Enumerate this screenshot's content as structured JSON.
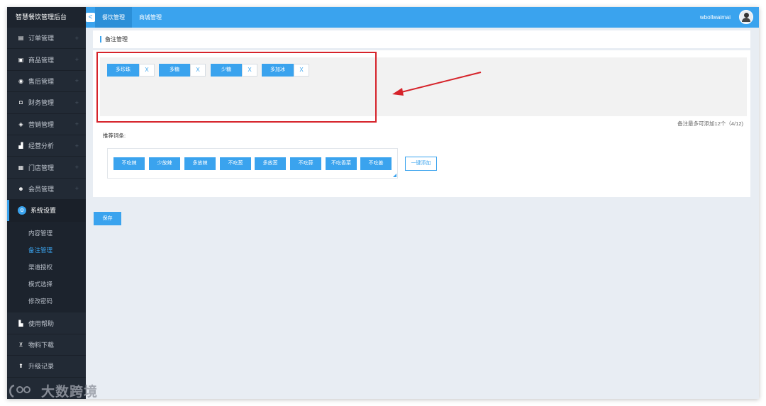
{
  "app": {
    "title": "智慧餐饮管理后台"
  },
  "sidebar": {
    "items": [
      {
        "label": "订单管理",
        "icon": "document-icon"
      },
      {
        "label": "商品管理",
        "icon": "box-icon"
      },
      {
        "label": "售后管理",
        "icon": "eye-icon"
      },
      {
        "label": "财务管理",
        "icon": "wallet-icon"
      },
      {
        "label": "营销管理",
        "icon": "megaphone-icon"
      },
      {
        "label": "经营分析",
        "icon": "bar-chart-icon"
      },
      {
        "label": "门店管理",
        "icon": "store-icon"
      },
      {
        "label": "会员管理",
        "icon": "users-icon"
      },
      {
        "label": "系统设置",
        "icon": "settings-icon"
      }
    ],
    "sub_items": [
      {
        "label": "内容管理"
      },
      {
        "label": "备注管理"
      },
      {
        "label": "渠道授权"
      },
      {
        "label": "模式选择"
      },
      {
        "label": "修改密码"
      }
    ],
    "bottom_items": [
      {
        "label": "使用帮助",
        "icon": "book-icon"
      },
      {
        "label": "物料下载",
        "icon": "download-icon"
      },
      {
        "label": "升级记录",
        "icon": "upgrade-icon"
      }
    ],
    "plus_symbol": "+"
  },
  "topbar": {
    "tabs": [
      {
        "label": "餐饮管理"
      },
      {
        "label": "商城管理"
      }
    ],
    "username": "wbollwaimai",
    "collapse_symbol": "<"
  },
  "page": {
    "breadcrumb": "备注管理",
    "tags": [
      {
        "label": "多珍珠",
        "close": "X"
      },
      {
        "label": "多糖",
        "close": "X"
      },
      {
        "label": "少糖",
        "close": "X"
      },
      {
        "label": "多加冰",
        "close": "X"
      }
    ],
    "limit_text": "备注最多可添加12个（4/12)",
    "recommend_label": "推荐词条:",
    "recommend_tags": [
      {
        "label": "不吃辣"
      },
      {
        "label": "少放辣"
      },
      {
        "label": "多放辣"
      },
      {
        "label": "不吃葱"
      },
      {
        "label": "多放葱"
      },
      {
        "label": "不吃蒜"
      },
      {
        "label": "不吃香菜"
      },
      {
        "label": "不吃姜"
      }
    ],
    "add_all_label": "一键添加",
    "save_label": "保存"
  },
  "watermark": {
    "text": "大数跨境"
  },
  "colors": {
    "accent": "#3aa3ee",
    "sidebar_bg": "#222a35",
    "annotation": "#d6232a"
  }
}
